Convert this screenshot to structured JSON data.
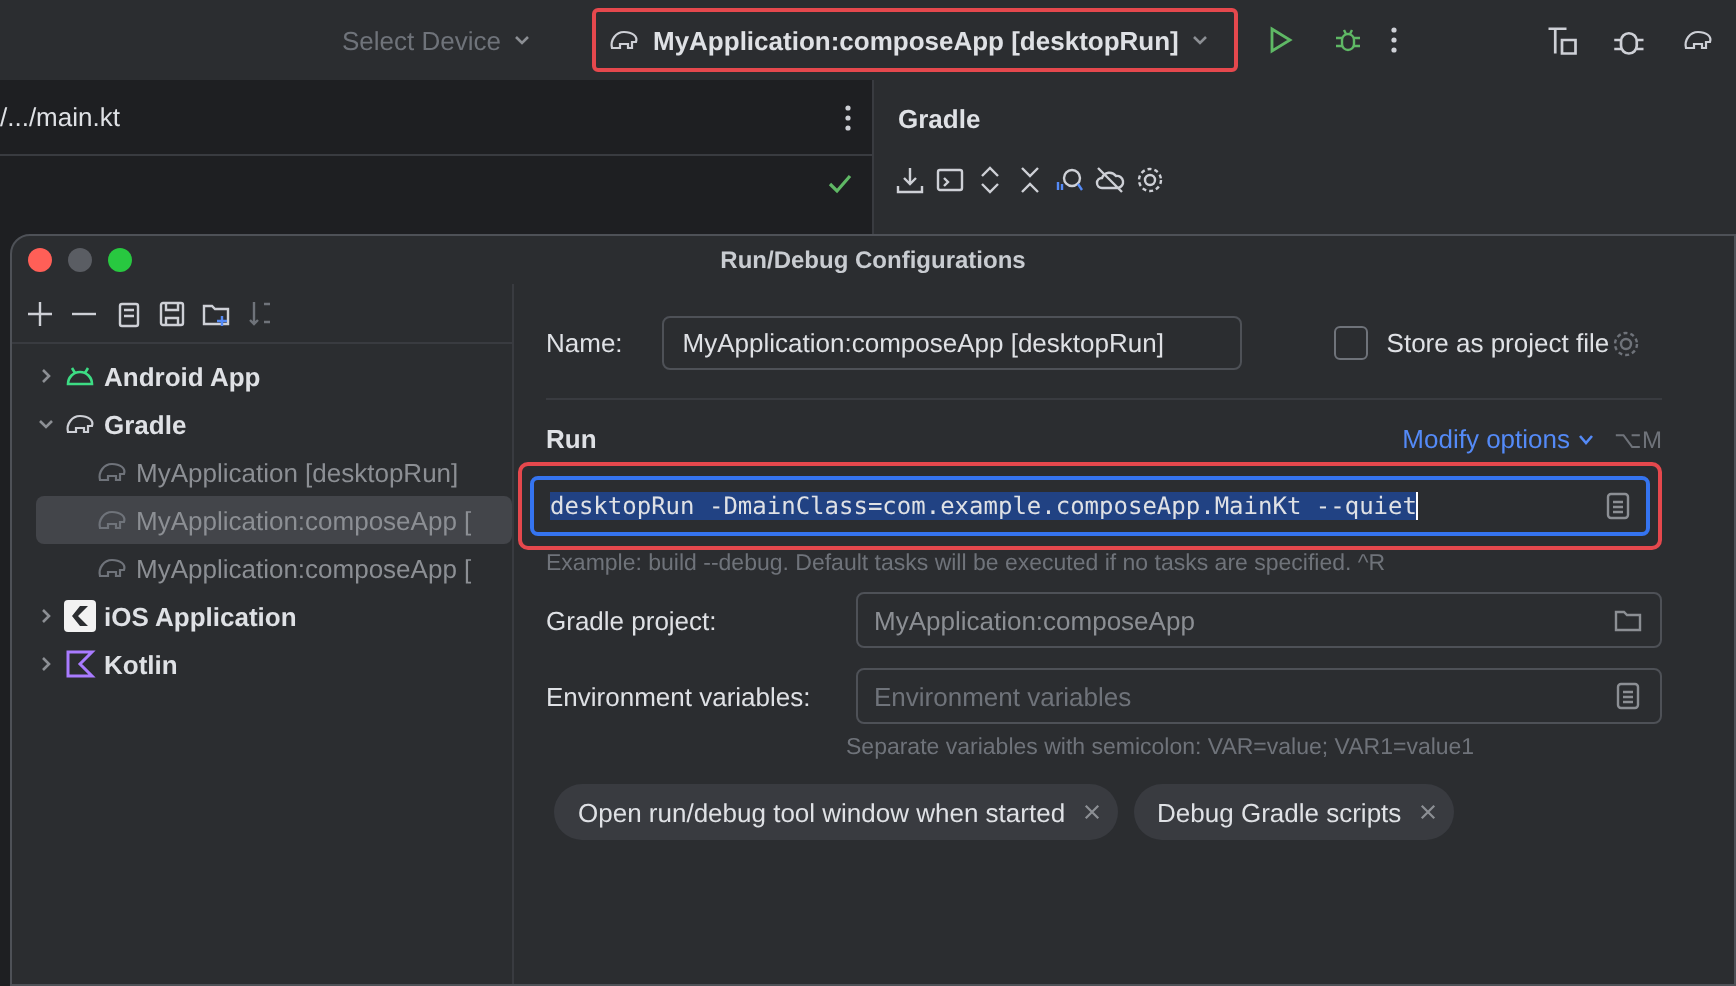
{
  "toolbar": {
    "device_selector": "Select Device",
    "run_config": "MyApplication:composeApp [desktopRun]"
  },
  "editor": {
    "tab": "/.../main.kt"
  },
  "gradle_panel": {
    "title": "Gradle"
  },
  "dialog": {
    "title": "Run/Debug Configurations",
    "tree": [
      {
        "label": "Android App",
        "kind": "android",
        "expanded": false,
        "selected": false
      },
      {
        "label": "Gradle",
        "kind": "gradle",
        "expanded": true,
        "selected": false,
        "children": [
          {
            "label": "MyApplication [desktopRun]",
            "selected": false
          },
          {
            "label": "MyApplication:composeApp [",
            "selected": true
          },
          {
            "label": "MyApplication:composeApp [",
            "selected": false
          }
        ]
      },
      {
        "label": "iOS Application",
        "kind": "ios",
        "expanded": false,
        "selected": false
      },
      {
        "label": "Kotlin",
        "kind": "kotlin",
        "expanded": false,
        "selected": false
      }
    ],
    "name_label": "Name:",
    "name_value": "MyApplication:composeApp [desktopRun]",
    "store_as_project_file": {
      "label": "Store as project file",
      "checked": false
    },
    "run_section": "Run",
    "modify_options": "Modify options",
    "modify_shortcut": "⌥M",
    "run_value": "desktopRun -DmainClass=com.example.composeApp.MainKt --quiet",
    "run_hint": "Example: build --debug. Default tasks will be executed if no tasks are specified. ^R",
    "gradle_project_label": "Gradle project:",
    "gradle_project_value": "MyApplication:composeApp",
    "env_label": "Environment variables:",
    "env_placeholder": "Environment variables",
    "env_hint": "Separate variables with semicolon: VAR=value; VAR1=value1",
    "chips": [
      "Open run/debug tool window when started",
      "Debug Gradle scripts"
    ]
  }
}
